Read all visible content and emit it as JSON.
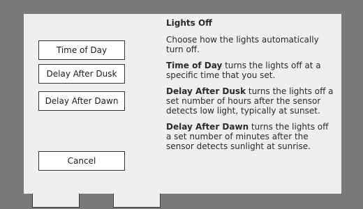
{
  "dialog": {
    "title": "Lights Off",
    "intro": "Choose how the lights automatically turn off.",
    "buttons": {
      "time_of_day": "Time of Day",
      "delay_after_dusk": "Delay After Dusk",
      "delay_after_dawn": "Delay After Dawn",
      "cancel": "Cancel"
    },
    "descriptions": [
      {
        "term": "Time of Day",
        "text": " turns the lights off at a specific time that you set."
      },
      {
        "term": "Delay After Dusk",
        "text": " turns the lights off a set number of hours after the sensor detects low light, typically at sunset."
      },
      {
        "term": "Delay After Dawn",
        "text": " turns the lights off a set number of minutes after the sensor detects sunlight at sunrise."
      }
    ]
  },
  "colors": {
    "overlay": "#7a7a7a",
    "dialog_background": "#efefef",
    "button_background": "#ffffff",
    "button_border": "#333333",
    "text": "#2a2a2a"
  }
}
